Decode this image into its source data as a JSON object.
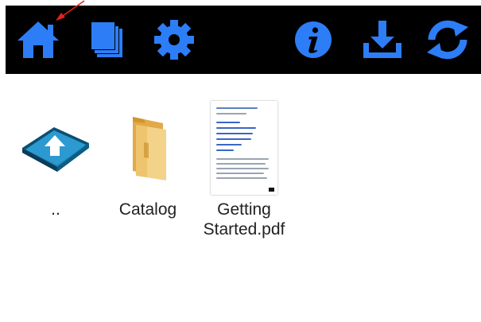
{
  "toolbar": {
    "accent": "#2d7df7",
    "buttons": [
      {
        "name": "home-button",
        "icon": "home-icon"
      },
      {
        "name": "documents-button",
        "icon": "documents-icon"
      },
      {
        "name": "settings-button",
        "icon": "gear-icon"
      },
      {
        "name": "info-button",
        "icon": "info-icon"
      },
      {
        "name": "download-button",
        "icon": "download-icon"
      },
      {
        "name": "sync-button",
        "icon": "refresh-icon"
      }
    ]
  },
  "files": [
    {
      "label": "..",
      "type": "parent-folder",
      "icon": "folder-up-icon"
    },
    {
      "label": "Catalog",
      "type": "folder",
      "icon": "folder-icon"
    },
    {
      "label": "Getting\nStarted.pdf",
      "type": "pdf",
      "icon": "pdf-thumbnail"
    }
  ],
  "pointer_color": "#e8211a"
}
